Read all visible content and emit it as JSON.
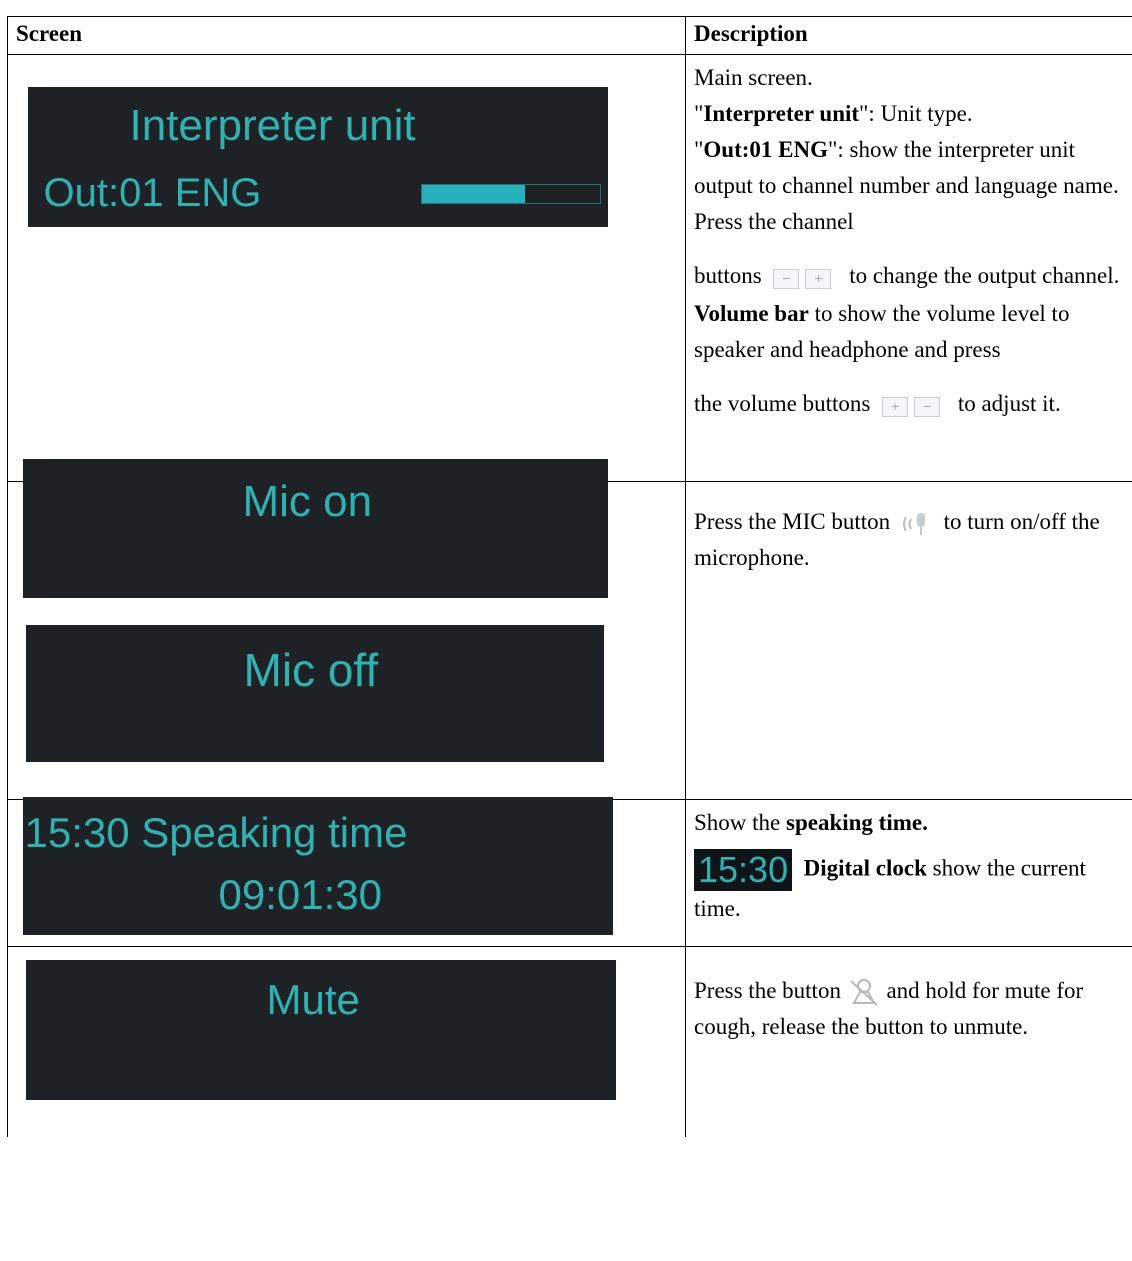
{
  "table": {
    "headers": [
      "Screen",
      "Description"
    ],
    "rows": [
      {
        "screen": {
          "title": "Interpreter unit",
          "output": "Out:01 ENG",
          "volume_level": 0.58
        },
        "desc": {
          "p1": "Main screen.",
          "p2_q1": "\"",
          "p2_b": "Interpreter unit",
          "p2_t": "\": Unit type.",
          "p3_q1": "\"",
          "p3_b": "Out:01 ENG",
          "p3_t": "\": show the interpreter unit output to channel number and language name. Press the channel",
          "p4_a": "buttons",
          "p4_b": "to change the output channel.",
          "p5_b": "Volume bar",
          "p5_t": "to show the volume level to speaker and headphone and press",
          "p6_a": "the volume buttons",
          "p6_b": "to adjust it."
        }
      },
      {
        "screen": {
          "mic_on": "Mic on",
          "mic_off": "Mic off"
        },
        "desc": {
          "a": "Press the MIC button",
          "b": "to turn on/off the microphone."
        }
      },
      {
        "screen": {
          "clock": "15:30",
          "label": "Speaking time",
          "time": "09:01:30"
        },
        "desc": {
          "a": "Show the",
          "b": "speaking time.",
          "clock": "15:30",
          "c_b": "Digital clock",
          "c_t": "show the current time."
        }
      },
      {
        "screen": {
          "mute": "Mute"
        },
        "desc": {
          "a": "Press the button",
          "b": "and hold for mute for cough, release the button to unmute."
        }
      }
    ]
  },
  "colors": {
    "lcd_bg": "#1e2226",
    "lcd_text": "#2eb2b2"
  },
  "icons": [
    "channel-buttons-icon",
    "volume-buttons-icon",
    "mic-button-icon",
    "mute-button-icon"
  ]
}
